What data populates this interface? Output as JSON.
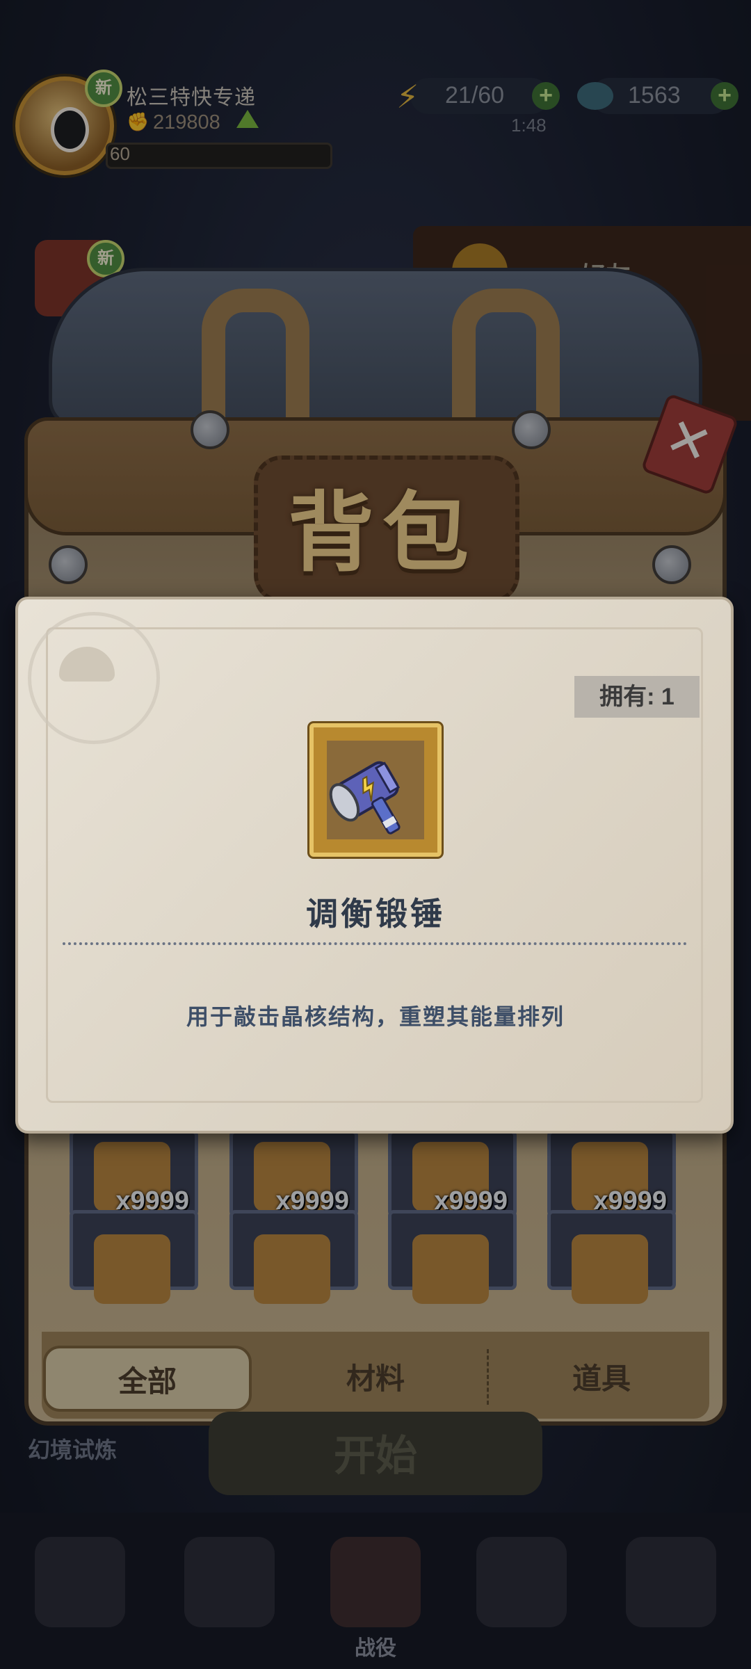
{
  "player": {
    "name": "松三特快专递",
    "power": "219808",
    "level": "60",
    "new_badge": "新"
  },
  "resources": {
    "energy": "21/60",
    "energy_timer": "1:48",
    "gems": "1563"
  },
  "side": {
    "friends_label": "好友",
    "gift_new_badge": "新"
  },
  "backpack": {
    "title": "背包",
    "grid_counts": [
      "x9999",
      "x9999",
      "x9999",
      "x9999"
    ],
    "tabs": [
      "全部",
      "材料",
      "道具"
    ],
    "active_tab": "全部"
  },
  "item_popup": {
    "owned_label": "拥有: 1",
    "name": "调衡锻锤",
    "description": "用于敲击晶核结构，重塑其能量排列",
    "icon": "hammer-icon"
  },
  "bottom": {
    "start_label": "开始",
    "trial_label": "幻境试炼",
    "nav_active_label": "战役"
  },
  "colors": {
    "popup_bg": "#e8e2d6",
    "title_gold": "#f2d089",
    "item_frame": "#e6c366",
    "desc_blue": "#3d4e67"
  }
}
